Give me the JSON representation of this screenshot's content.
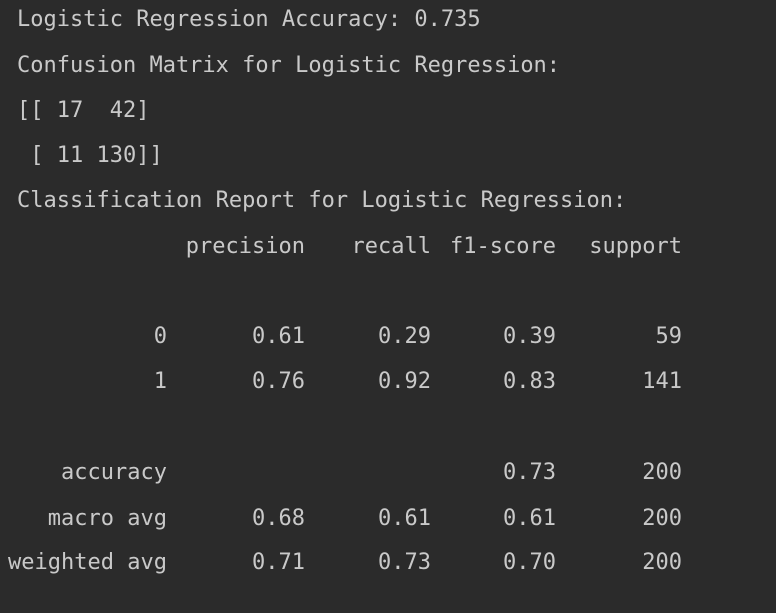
{
  "console": {
    "accuracy_line": "Logistic Regression Accuracy: 0.735",
    "confusion_title": "Confusion Matrix for Logistic Regression:",
    "matrix_row_1": "[[ 17  42]",
    "matrix_row_2": " [ 11 130]]",
    "report_title": "Classification Report for Logistic Regression:",
    "report": {
      "headers": [
        "precision",
        "recall",
        "f1-score",
        "support"
      ],
      "rows": [
        {
          "label": "0",
          "precision": "0.61",
          "recall": "0.29",
          "f1": "0.39",
          "support": "59"
        },
        {
          "label": "1",
          "precision": "0.76",
          "recall": "0.92",
          "f1": "0.83",
          "support": "141"
        },
        {
          "label": "accuracy",
          "precision": "",
          "recall": "",
          "f1": "0.73",
          "support": "200"
        },
        {
          "label": "macro avg",
          "precision": "0.68",
          "recall": "0.61",
          "f1": "0.61",
          "support": "200"
        },
        {
          "label": "weighted avg",
          "precision": "0.71",
          "recall": "0.73",
          "f1": "0.70",
          "support": "200"
        }
      ]
    }
  }
}
